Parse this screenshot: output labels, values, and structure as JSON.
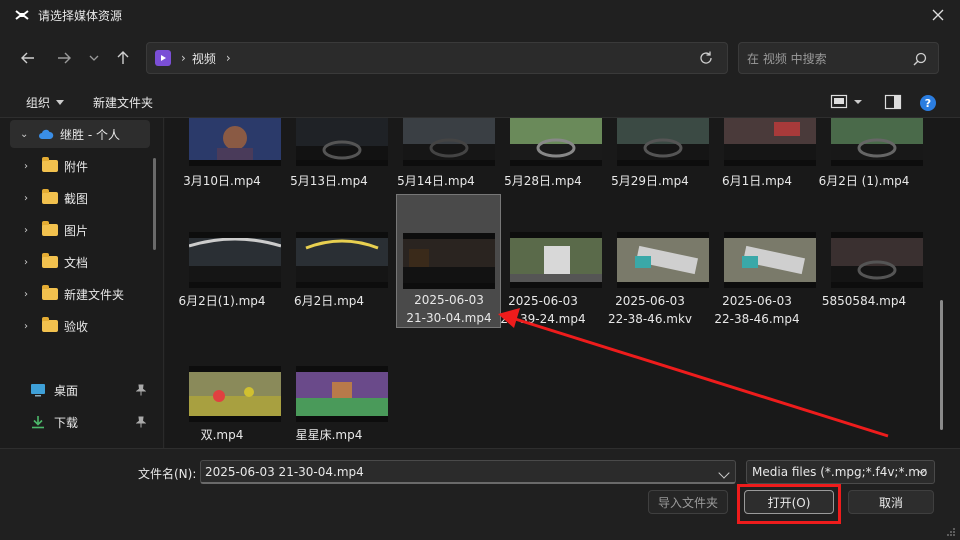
{
  "window": {
    "title": "请选择媒体资源",
    "app_icon": "capcut-logo-icon",
    "close_icon": "close-icon"
  },
  "navigation": {
    "back_icon": "arrow-left-icon",
    "forward_icon": "arrow-right-icon",
    "recent_icon": "chevron-down-icon",
    "up_icon": "arrow-up-icon",
    "breadcrumb": [
      "视频"
    ],
    "refresh_icon": "refresh-icon",
    "search_placeholder": "在 视频 中搜索"
  },
  "toolbar": {
    "organize_label": "组织",
    "new_folder_label": "新建文件夹",
    "view_icon": "view-toggle-icon",
    "preview_pane_icon": "preview-pane-icon",
    "help_icon": "help-icon"
  },
  "sidebar": {
    "items": [
      {
        "label": "继胜 - 个人",
        "icon": "onedrive-cloud-icon",
        "selected": true,
        "expanded": true
      },
      {
        "label": "附件",
        "icon": "folder-icon"
      },
      {
        "label": "截图",
        "icon": "folder-icon"
      },
      {
        "label": "图片",
        "icon": "folder-icon"
      },
      {
        "label": "文档",
        "icon": "folder-icon"
      },
      {
        "label": "新建文件夹",
        "icon": "folder-icon"
      },
      {
        "label": "验收",
        "icon": "folder-icon"
      }
    ],
    "quick_access": [
      {
        "label": "桌面",
        "icon": "desktop-icon",
        "pinned": true
      },
      {
        "label": "下载",
        "icon": "download-icon",
        "pinned": true
      }
    ]
  },
  "files": {
    "rows": [
      [
        {
          "name": "3月10日.mp4"
        },
        {
          "name": "5月13日.mp4"
        },
        {
          "name": "5月14日.mp4"
        },
        {
          "name": "5月28日.mp4"
        },
        {
          "name": "5月29日.mp4"
        },
        {
          "name": "6月1日.mp4"
        },
        {
          "name": "6月2日 (1).mp4"
        }
      ],
      [
        {
          "name": "6月2日(1).mp4"
        },
        {
          "name": "6月2日.mp4"
        },
        {
          "name_line1": "2025-06-03",
          "name_line2": "21-30-04.mp4",
          "selected": true
        },
        {
          "name_line1": "2025-06-03",
          "name_line2": "21-39-24.mp4"
        },
        {
          "name_line1": "2025-06-03",
          "name_line2": "22-38-46.mkv"
        },
        {
          "name_line1": "2025-06-03",
          "name_line2": "22-38-46.mp4"
        },
        {
          "name": "5850584.mp4"
        }
      ],
      [
        {
          "name": "双.mp4"
        },
        {
          "name": "星星床.mp4"
        }
      ]
    ]
  },
  "bottom": {
    "filename_label": "文件名(N):",
    "filename_value": "2025-06-03 21-30-04.mp4",
    "filetype_value": "Media files (*.mpg;*.f4v;*.mo",
    "import_folder_label": "导入文件夹",
    "open_label": "打开(O)",
    "cancel_label": "取消"
  },
  "annotation_colors": {
    "highlight": "#ee1c1c",
    "selection": "#4a4a4a"
  }
}
